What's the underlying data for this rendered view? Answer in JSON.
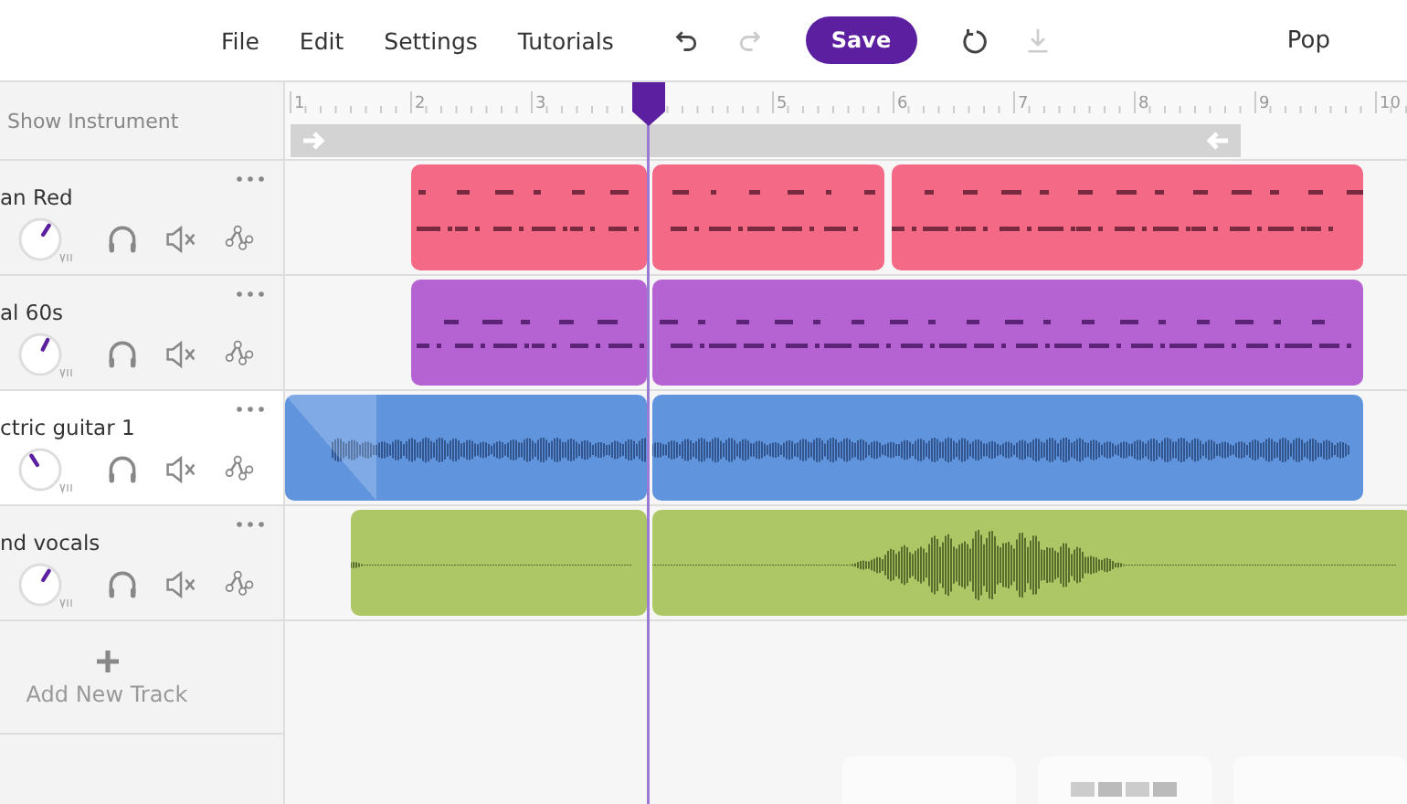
{
  "menu": [
    "File",
    "Edit",
    "Settings",
    "Tutorials"
  ],
  "toolbar": {
    "undo_disabled": false,
    "redo_disabled": true,
    "save": "Save",
    "download_disabled": true
  },
  "genre": "Pop",
  "show_instrument": "Show Instrument",
  "ruler": [
    "1",
    "2",
    "3",
    "5",
    "6",
    "7",
    "8",
    "9",
    "10"
  ],
  "tracks": [
    {
      "name": "an Red",
      "kind": "midi",
      "color": "#f46a86",
      "selected": false,
      "level": 0.62
    },
    {
      "name": "al 60s",
      "kind": "midi",
      "color": "#b562d3",
      "selected": false,
      "level": 0.6
    },
    {
      "name": "ctric guitar 1",
      "kind": "audio",
      "color": "#6095de",
      "selected": true,
      "level": 0.38
    },
    {
      "name": "nd vocals",
      "kind": "audio",
      "color": "#aec766",
      "selected": false,
      "level": 0.62
    }
  ],
  "add_track": "Add New Track"
}
